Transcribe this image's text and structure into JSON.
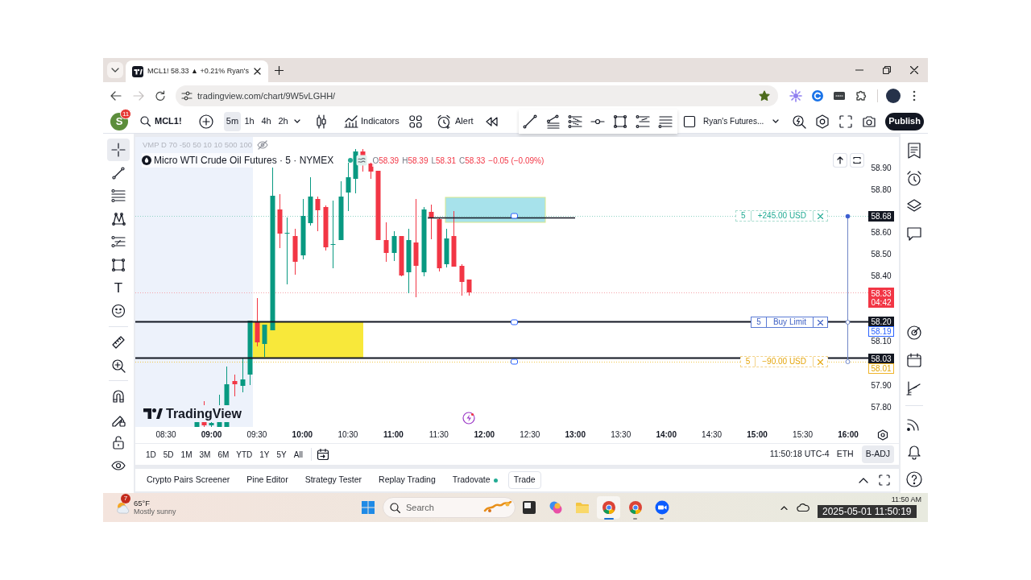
{
  "browser": {
    "tabs": [
      {
        "title": "MCL1! 58.33 ▲ +0.21% Ryan's",
        "selected": true
      }
    ],
    "can_go_forward": false,
    "url": "tradingview.com/chart/9W5vLGHH/",
    "bookmarked": true
  },
  "toolbar": {
    "avatar": "S",
    "badge": "11",
    "symbol": "MCL1!",
    "intervals": [
      {
        "label": "5m",
        "selected": true
      },
      {
        "label": "1h",
        "selected": false
      },
      {
        "label": "4h",
        "selected": false
      },
      {
        "label": "2h",
        "selected": false
      }
    ],
    "indicators": "Indicators",
    "alert": "Alert",
    "layout": "Ryan's Futures...",
    "publish": "Publish"
  },
  "left_tools": [
    {
      "kind": "crosshair",
      "selected": true
    },
    {
      "kind": "trendline",
      "selected": false
    },
    {
      "kind": "lines",
      "selected": false
    },
    {
      "kind": "pattern",
      "selected": false
    },
    {
      "kind": "levels",
      "selected": false
    },
    {
      "kind": "rectangle",
      "selected": false
    },
    {
      "kind": "text",
      "glyph": "T",
      "selected": false
    },
    {
      "kind": "smiley",
      "selected": false
    },
    {
      "kind": "ruler",
      "selected": false
    },
    {
      "kind": "zoom",
      "selected": false
    },
    {
      "kind": "magnet",
      "selected": false
    },
    {
      "kind": "pencillock",
      "selected": false
    },
    {
      "kind": "unlock",
      "selected": false
    },
    {
      "kind": "eye",
      "selected": false
    }
  ],
  "chart": {
    "indicator": "VMP D 70 -50 50 10 10 500 100",
    "title": "Micro WTI Crude Oil Futures · 5 · NYMEX",
    "market_open": true,
    "ohlc": [
      {
        "label": "O",
        "value": "58.39"
      },
      {
        "label": "H",
        "value": "58.39"
      },
      {
        "label": "L",
        "value": "58.31"
      },
      {
        "label": "C",
        "value": "58.33"
      }
    ],
    "change": "−0.05 (−0.09%)",
    "brand": "TradingView",
    "orders": [
      {
        "kind": "profit",
        "qty": "5",
        "label": "+245.00 USD"
      },
      {
        "kind": "entry",
        "qty": "5",
        "label": "Buy Limit"
      },
      {
        "kind": "loss",
        "qty": "5",
        "label": "−90.00 USD"
      }
    ],
    "price_scale": [
      {
        "text": "58.90",
        "kind": "tick"
      },
      {
        "text": "58.80",
        "kind": "tick"
      },
      {
        "text": "58.68",
        "kind": "order"
      },
      {
        "text": "58.60",
        "kind": "tick"
      },
      {
        "text": "58.50",
        "kind": "tick"
      },
      {
        "text": "58.40",
        "kind": "tick"
      },
      {
        "text": "58.33",
        "kind": "last",
        "countdown": "04:42"
      },
      {
        "text": "58.20",
        "kind": "order"
      },
      {
        "text": "58.19",
        "kind": "entry"
      },
      {
        "text": "58.10",
        "kind": "tick"
      },
      {
        "text": "58.03",
        "kind": "order"
      },
      {
        "text": "58.01",
        "kind": "stop"
      },
      {
        "text": "57.90",
        "kind": "tick"
      },
      {
        "text": "57.80",
        "kind": "tick"
      }
    ],
    "time_axis": [
      {
        "label": "08:30",
        "major": false
      },
      {
        "label": "09:00",
        "major": true
      },
      {
        "label": "09:30",
        "major": false
      },
      {
        "label": "10:00",
        "major": true
      },
      {
        "label": "10:30",
        "major": false
      },
      {
        "label": "11:00",
        "major": true
      },
      {
        "label": "11:30",
        "major": false
      },
      {
        "label": "12:00",
        "major": true
      },
      {
        "label": "12:30",
        "major": false
      },
      {
        "label": "13:00",
        "major": true
      },
      {
        "label": "13:30",
        "major": false
      },
      {
        "label": "14:00",
        "major": true
      },
      {
        "label": "14:30",
        "major": false
      },
      {
        "label": "15:00",
        "major": true
      },
      {
        "label": "15:30",
        "major": false
      },
      {
        "label": "16:00",
        "major": true
      }
    ]
  },
  "ranges": [
    "1D",
    "5D",
    "1M",
    "3M",
    "6M",
    "YTD",
    "1Y",
    "5Y",
    "All"
  ],
  "status": {
    "clock": "11:50:18 UTC-4",
    "session": "ETH",
    "adjustment": {
      "label": "B-ADJ",
      "on": true
    }
  },
  "bottom_tabs": [
    {
      "label": "Crypto Pairs Screener",
      "kind": "tab",
      "connected": false
    },
    {
      "label": "Pine Editor",
      "kind": "tab",
      "connected": false
    },
    {
      "label": "Strategy Tester",
      "kind": "tab",
      "connected": false
    },
    {
      "label": "Replay Trading",
      "kind": "tab",
      "connected": false
    },
    {
      "label": "Tradovate",
      "kind": "tab",
      "connected": true
    },
    {
      "label": "Trade",
      "kind": "button",
      "connected": false
    }
  ],
  "taskbar": {
    "weather": {
      "temperature": "65°F",
      "condition": "Mostly sunny",
      "badge": "7"
    },
    "search": {
      "placeholder": "Search"
    },
    "apps": [
      {
        "kind": "window",
        "active": false,
        "running": false
      },
      {
        "kind": "swirl",
        "active": false,
        "running": false
      },
      {
        "kind": "folder",
        "active": false,
        "running": false
      },
      {
        "kind": "browser",
        "active": true,
        "running": true
      },
      {
        "kind": "browser",
        "active": false,
        "running": true
      },
      {
        "kind": "video",
        "active": false,
        "running": true
      }
    ],
    "time": "11:50 AM"
  },
  "recording_timestamp": "2025-05-01 11:50:19"
}
